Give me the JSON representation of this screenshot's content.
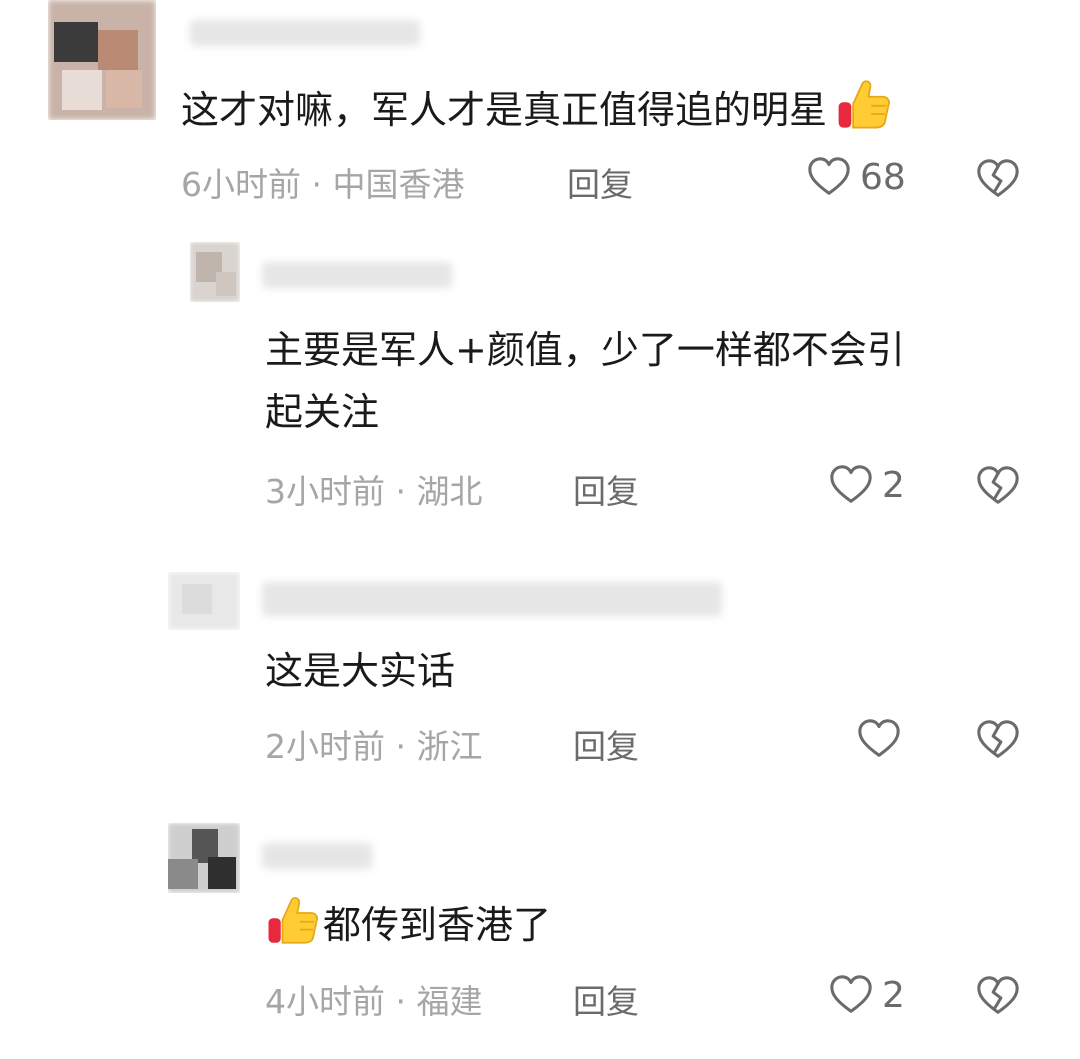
{
  "comments": [
    {
      "text": "这才对嘛，军人才是真正值得追的明星",
      "emoji": "thumbs-up-icon",
      "time": "6小时前",
      "location": "中国香港",
      "reply_label": "回复",
      "likes": "68"
    },
    {
      "text_line1": "主要是军人+颜值，少了一样都不会引",
      "text_line2": "起关注",
      "time": "3小时前",
      "location": "湖北",
      "reply_label": "回复",
      "likes": "2"
    },
    {
      "text": "这是大实话",
      "time": "2小时前",
      "location": "浙江",
      "reply_label": "回复",
      "likes": ""
    },
    {
      "emoji": "thumbs-up-icon",
      "text": "都传到香港了",
      "time": "4小时前",
      "location": "福建",
      "reply_label": "回复",
      "likes": "2"
    }
  ],
  "separator": " · "
}
